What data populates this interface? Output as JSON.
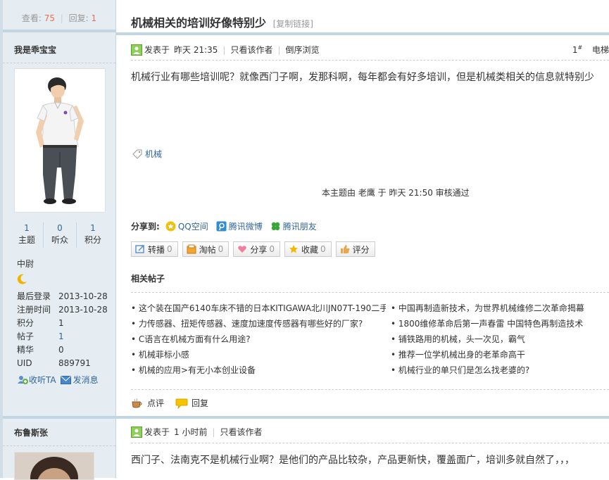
{
  "stats": {
    "views_label": "查看:",
    "views": "75",
    "replies_label": "回复:",
    "replies": "1"
  },
  "thread": {
    "title": "机械相关的培训好像特别少",
    "copy_link": "[复制链接]"
  },
  "post1": {
    "author": "我是乖宝宝",
    "posted_label": "发表于",
    "posted_time": "昨天 21:35",
    "only_author": "只看该作者",
    "reverse": "倒序浏览",
    "floor_num": "1",
    "floor_suffix": "#",
    "floor_label": "电梯",
    "content": "机械行业有哪些培训呢？就像西门子啊，发那科啊，每年都会有好多培训，但是机械类相关的信息就特别少",
    "tag": "机械",
    "audit": "本主题由  老鹰  于  昨天 21:50 审核通过",
    "share_label": "分享到:",
    "share_items": [
      "QQ空间",
      "腾讯微博",
      "腾讯朋友"
    ],
    "buttons": [
      {
        "label": "转播",
        "count": "0"
      },
      {
        "label": "淘帖",
        "count": "0"
      },
      {
        "label": "分享",
        "count": "0"
      },
      {
        "label": "收藏",
        "count": "0"
      },
      {
        "label": "评分",
        "count": ""
      }
    ],
    "related_title": "相关帖子",
    "related_left": [
      "• 这个装在国产6140车床不错的日本KITIGAWA北川JN07T-190二手",
      "• 力传感器、扭矩传感器、速度加速度传感器有哪些好的厂家?",
      "• C语言在机械方面有什么用途?",
      "• 机械菲标小感",
      "• 机械的应用>有无小本创业设备"
    ],
    "related_right": [
      "• 中国再制造新技术，为世界机械维修二次革命揭幕",
      "• 1800维修革命后第一声春雷  中国特色再制造技术",
      "• 铺铁路用的机械，头一次见，霸气",
      "• 推荐一位学机械出身的老革命高干",
      "• 机械行业的单只们是怎么找老婆的?"
    ],
    "comment_label": "点评",
    "reply_label": "回复"
  },
  "user1": {
    "topics_num": "1",
    "topics_label": "主题",
    "fans_num": "0",
    "fans_label": "听众",
    "points_num": "1",
    "points_label": "积分",
    "rank": "中尉",
    "info": [
      {
        "k": "最后登录",
        "v": "2013-10-28"
      },
      {
        "k": "注册时间",
        "v": "2013-10-28"
      },
      {
        "k": "积分",
        "v": "1"
      },
      {
        "k": "帖子",
        "v": "1"
      },
      {
        "k": "精华",
        "v": "0"
      },
      {
        "k": "UID",
        "v": "889791"
      }
    ],
    "follow": "收听TA",
    "message": "发消息"
  },
  "post2": {
    "author": "布鲁斯张",
    "posted_label": "发表于",
    "posted_time": "1 小时前",
    "only_author": "只看该作者",
    "content": "西门子、法南克不是机械行业啊？是他们的产品比较杂，产品更新快，覆盖面广，培训多就自然了，，，"
  },
  "colors": {
    "accent": "#369",
    "count": "#f26c4f",
    "sidebar_bg": "#e5edf2",
    "border": "#c2d5e3"
  }
}
